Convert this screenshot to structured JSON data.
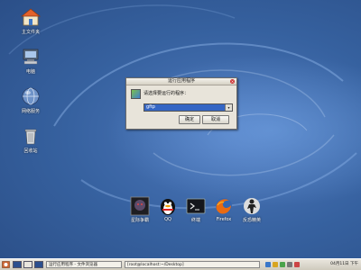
{
  "desktop": {
    "icons": [
      {
        "label": "主文件夹",
        "icon": "home-folder-icon"
      },
      {
        "label": "电脑",
        "icon": "computer-icon"
      },
      {
        "label": "网络服务",
        "icon": "network-globe-icon"
      },
      {
        "label": "回收站",
        "icon": "trash-icon"
      }
    ]
  },
  "dialog": {
    "title": "运行应用程序",
    "prompt": "请选择要运行的程序：",
    "combo_value": "gftp",
    "ok_label": "确定",
    "cancel_label": "取消"
  },
  "dock": {
    "items": [
      {
        "label": "星际争霸",
        "icon": "starcraft-icon"
      },
      {
        "label": "QQ",
        "icon": "qq-penguin-icon"
      },
      {
        "label": "终端",
        "icon": "terminal-icon"
      },
      {
        "label": "Firefox",
        "icon": "firefox-icon"
      },
      {
        "label": "反恐精英",
        "icon": "counter-strike-icon"
      }
    ]
  },
  "taskbar": {
    "task1": "运行应用程序 - 文件浏览器",
    "task2": "[root@localhost:~/Desktop]",
    "clock": "04月11日 下午"
  },
  "colors": {
    "desktop_blue": "#2c4f8e",
    "combo_highlight": "#3566c4",
    "dialog_bg": "#e8e4da"
  }
}
